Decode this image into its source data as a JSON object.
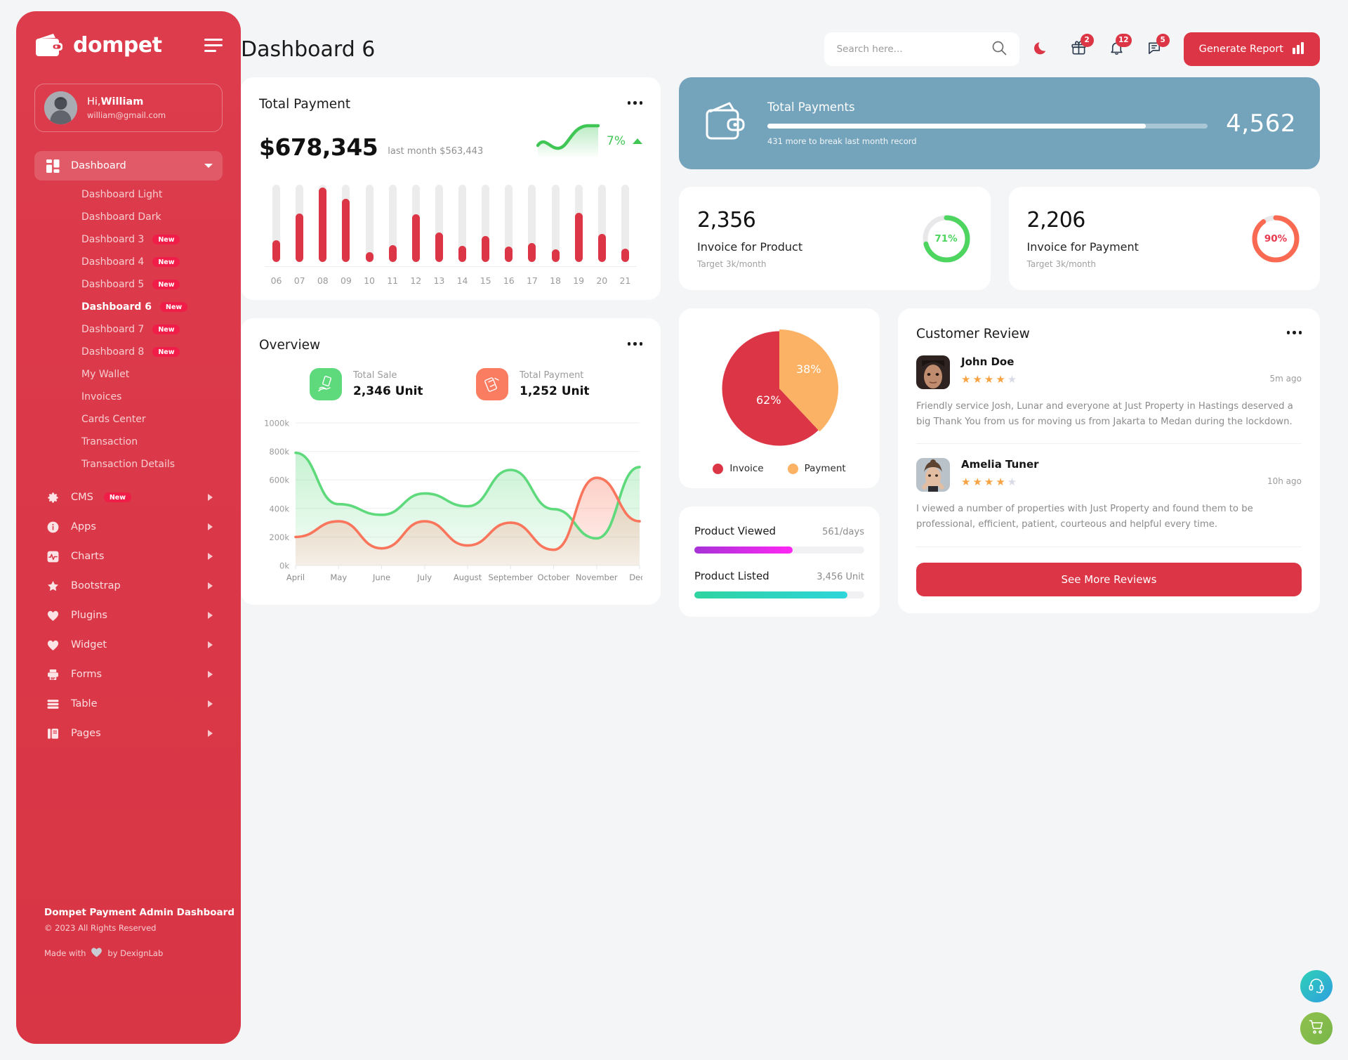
{
  "brand": {
    "name": "dompet",
    "logo_icon": "wallet-icon",
    "menu_toggle_icon": "hamburger-icon"
  },
  "profile": {
    "greeting_prefix": "Hi,",
    "name": "William",
    "email": "william@gmail.com"
  },
  "sidebar": {
    "dashboard": {
      "label": "Dashboard",
      "icon": "grid-icon",
      "caret": "chevron-down-icon"
    },
    "submenu": [
      {
        "label": "Dashboard Light",
        "badge": ""
      },
      {
        "label": "Dashboard Dark",
        "badge": ""
      },
      {
        "label": "Dashboard 3",
        "badge": "New"
      },
      {
        "label": "Dashboard 4",
        "badge": "New"
      },
      {
        "label": "Dashboard 5",
        "badge": "New"
      },
      {
        "label": "Dashboard 6",
        "badge": "New"
      },
      {
        "label": "Dashboard 7",
        "badge": "New"
      },
      {
        "label": "Dashboard 8",
        "badge": "New"
      },
      {
        "label": "My Wallet",
        "badge": ""
      },
      {
        "label": "Invoices",
        "badge": ""
      },
      {
        "label": "Cards Center",
        "badge": ""
      },
      {
        "label": "Transaction",
        "badge": ""
      },
      {
        "label": "Transaction Details",
        "badge": ""
      }
    ],
    "groups": [
      {
        "label": "CMS",
        "icon": "gear-icon",
        "badge": "New"
      },
      {
        "label": "Apps",
        "icon": "info-icon",
        "badge": ""
      },
      {
        "label": "Charts",
        "icon": "pulse-icon",
        "badge": ""
      },
      {
        "label": "Bootstrap",
        "icon": "star-icon",
        "badge": ""
      },
      {
        "label": "Plugins",
        "icon": "heart-icon",
        "badge": ""
      },
      {
        "label": "Widget",
        "icon": "heart-icon",
        "badge": ""
      },
      {
        "label": "Forms",
        "icon": "printer-icon",
        "badge": ""
      },
      {
        "label": "Table",
        "icon": "table-icon",
        "badge": ""
      },
      {
        "label": "Pages",
        "icon": "pages-icon",
        "badge": ""
      }
    ],
    "footer": {
      "title": "Dompet Payment Admin Dashboard",
      "copyright": "© 2023 All Rights Reserved",
      "made_prefix": "Made with",
      "made_suffix": "by DexignLab"
    }
  },
  "header": {
    "page_title": "Dashboard 6",
    "search_placeholder": "Search here...",
    "search_value": "",
    "search_icon": "search-icon",
    "theme_toggle_icon": "moon-icon",
    "icons": [
      {
        "name": "gift-icon",
        "badge": "2"
      },
      {
        "name": "bell-icon",
        "badge": "12"
      },
      {
        "name": "message-icon",
        "badge": "5"
      }
    ],
    "generate_report_label": "Generate Report",
    "generate_report_icon": "bar-chart-icon"
  },
  "total_payment": {
    "title": "Total Payment",
    "amount": "$678,345",
    "last_month": "last month $563,443",
    "change_pct": "7%",
    "trend_icon": "triangle-up-icon",
    "menu_icon": "more-icon"
  },
  "total_payments_blue": {
    "title": "Total Payments",
    "value": "4,562",
    "note": "431 more to break last month record",
    "progress": 86,
    "icon": "wallet-icon",
    "bg_color": "#74a4bc"
  },
  "invoice_product": {
    "value": "2,356",
    "label": "Invoice for Product",
    "target": "Target 3k/month",
    "percent": "71%",
    "percent_value": 71,
    "color": "#4dd55f"
  },
  "invoice_payment": {
    "value": "2,206",
    "label": "Invoice for Payment",
    "target": "Target 3k/month",
    "percent": "90%",
    "percent_value": 90,
    "color": "#fa6a52"
  },
  "overview": {
    "title": "Overview",
    "menu_icon": "more-icon",
    "stats": [
      {
        "label": "Total Sale",
        "value": "2,346 Unit",
        "icon": "hand-money-icon",
        "color": "#5ed97c"
      },
      {
        "label": "Total Payment",
        "value": "1,252 Unit",
        "icon": "card-terminal-icon",
        "color": "#fa7d62"
      }
    ]
  },
  "pie_card": {
    "legend": [
      {
        "label": "Invoice",
        "color": "#dc3545"
      },
      {
        "label": "Payment",
        "color": "#fbb264"
      }
    ]
  },
  "products": [
    {
      "name": "Product Viewed",
      "meta": "561/days",
      "percent": 58,
      "color_from": "#a633d6",
      "color_to": "#ff27f4"
    },
    {
      "name": "Product Listed",
      "meta": "3,456 Unit",
      "percent": 90,
      "color_from": "#2fd4a0",
      "color_to": "#2ed5da"
    }
  ],
  "customer_review": {
    "title": "Customer Review",
    "menu_icon": "more-icon",
    "see_more_label": "See More Reviews",
    "reviews": [
      {
        "name": "John Doe",
        "stars": 4,
        "max_stars": 5,
        "time": "5m ago",
        "text": "Friendly service Josh, Lunar and everyone at Just Property in Hastings deserved a big Thank You from us for moving us from Jakarta to Medan during the lockdown."
      },
      {
        "name": "Amelia Tuner",
        "stars": 4,
        "max_stars": 5,
        "time": "10h ago",
        "text": "I viewed a number of properties with Just Property and found them to be professional, efficient, patient, courteous and helpful every time."
      }
    ]
  },
  "fabs": [
    {
      "name": "support-icon",
      "color": "#2ed1b6"
    },
    {
      "name": "cart-icon",
      "color": "#8fc14c"
    }
  ],
  "chart_data": [
    {
      "type": "bar",
      "title": "Total Payment",
      "categories": [
        "06",
        "07",
        "08",
        "09",
        "10",
        "11",
        "12",
        "13",
        "14",
        "15",
        "16",
        "17",
        "18",
        "19",
        "20",
        "21"
      ],
      "values": [
        28,
        63,
        96,
        82,
        13,
        22,
        62,
        38,
        21,
        34,
        20,
        25,
        16,
        64,
        36,
        17
      ],
      "track_max": 100,
      "xlabel": "",
      "ylabel": "",
      "ylim": [
        0,
        100
      ],
      "grid": false,
      "series_color": "#dc3545",
      "track_color": "#ececed"
    },
    {
      "type": "area",
      "title": "Overview",
      "x": [
        "April",
        "May",
        "June",
        "July",
        "August",
        "September",
        "October",
        "November",
        "Dec.."
      ],
      "ytick_labels": [
        "0k",
        "200k",
        "400k",
        "600k",
        "800k",
        "1000k"
      ],
      "ylim": [
        0,
        1000000
      ],
      "grid": true,
      "legend": "none",
      "series": [
        {
          "name": "Total Sale",
          "color": "#5ed97c",
          "values": [
            790000,
            430000,
            355000,
            505000,
            415000,
            670000,
            395000,
            190000,
            690000
          ]
        },
        {
          "name": "Total Payment",
          "color": "#f9755c",
          "values": [
            200000,
            310000,
            120000,
            310000,
            140000,
            300000,
            110000,
            615000,
            310000
          ]
        }
      ]
    },
    {
      "type": "pie",
      "labels": [
        "Invoice",
        "Payment"
      ],
      "values": [
        62,
        38
      ],
      "value_labels": [
        "62%",
        "38%"
      ],
      "colors": [
        "#dc3545",
        "#fbb264"
      ],
      "legend": "bottom"
    }
  ]
}
